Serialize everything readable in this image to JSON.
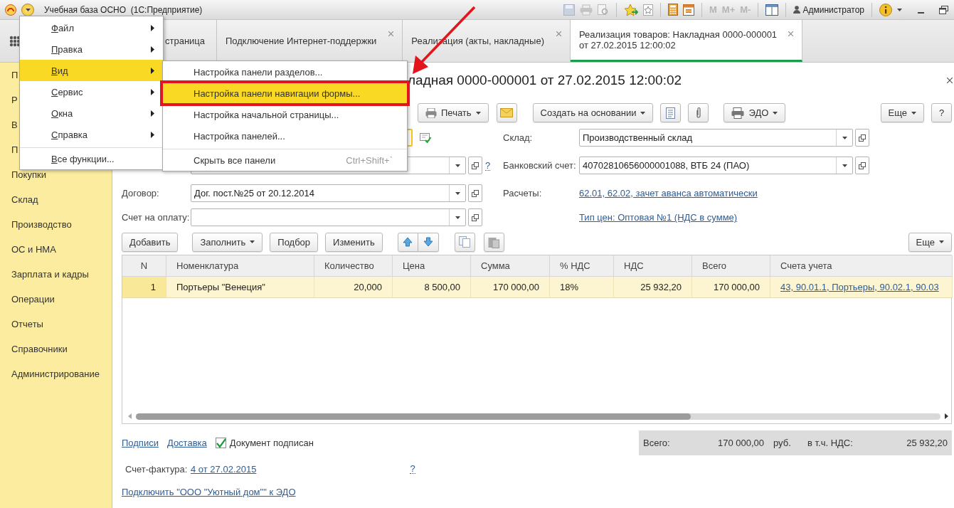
{
  "window": {
    "title": "Учебная база ОСНО  (1С:Предприятие)",
    "memory_buttons": [
      {
        "label": "M",
        "disabled": true
      },
      {
        "label": "M+",
        "disabled": true
      },
      {
        "label": "M-",
        "disabled": true
      }
    ],
    "user": "Администратор"
  },
  "tabs": [
    {
      "label": "страница",
      "selected": false,
      "closable": false
    },
    {
      "label": "Подключение Интернет-поддержки",
      "selected": false,
      "closable": true
    },
    {
      "label": "Реализация (акты, накладные)",
      "selected": false,
      "closable": true
    },
    {
      "label": "Реализация товаров: Накладная 0000-000001 от 27.02.2015 12:00:02",
      "selected": true,
      "closable": true
    }
  ],
  "sidebar": {
    "items": [
      {
        "label": "П"
      },
      {
        "label": "Р"
      },
      {
        "label": "В"
      },
      {
        "label": "П"
      },
      {
        "label": "Покупки"
      },
      {
        "label": "Склад"
      },
      {
        "label": "Производство"
      },
      {
        "label": "ОС и НМА"
      },
      {
        "label": "Зарплата и кадры"
      },
      {
        "label": "Операции"
      },
      {
        "label": "Отчеты"
      },
      {
        "label": "Справочники"
      },
      {
        "label": "Администрирование"
      }
    ]
  },
  "main_menu": {
    "items": [
      {
        "label": "Файл",
        "selected": false,
        "has_submenu": true,
        "separator_before": false
      },
      {
        "label": "Правка",
        "selected": false,
        "has_submenu": true,
        "separator_before": false
      },
      {
        "label": "Вид",
        "selected": true,
        "has_submenu": true,
        "separator_before": false
      },
      {
        "label": "Сервис",
        "selected": false,
        "has_submenu": true,
        "separator_before": false
      },
      {
        "label": "Окна",
        "selected": false,
        "has_submenu": true,
        "separator_before": false
      },
      {
        "label": "Справка",
        "selected": false,
        "has_submenu": true,
        "separator_before": false
      },
      {
        "label": "Все функции...",
        "selected": false,
        "has_submenu": false,
        "separator_before": true
      }
    ]
  },
  "submenu": {
    "items": [
      {
        "label": "Настройка панели разделов...",
        "selected": false,
        "highlighted": false,
        "separator_before": false
      },
      {
        "label": "Настройка панели навигации формы...",
        "selected": true,
        "highlighted": true,
        "separator_before": false
      },
      {
        "label": "Настройка начальной страницы...",
        "selected": false,
        "highlighted": false,
        "separator_before": false
      },
      {
        "label": "Настройка панелей...",
        "selected": false,
        "highlighted": false,
        "separator_before": false
      },
      {
        "label": "Скрыть все панели",
        "shortcut": "Ctrl+Shift+`",
        "selected": false,
        "highlighted": false,
        "separator_before": true
      }
    ]
  },
  "form": {
    "title": "ладная 0000-000001 от 27.02.2015 12:00:02",
    "toolbar": [
      {
        "kind": "print",
        "label": "Печать",
        "dropdown": true
      },
      {
        "kind": "mail"
      },
      {
        "kind": "text",
        "label": "Создать на основании",
        "dropdown": true
      },
      {
        "kind": "report"
      },
      {
        "kind": "attach"
      },
      {
        "kind": "edo",
        "label": "ЭДО",
        "dropdown": true
      }
    ],
    "more": "Еще",
    "help": "?",
    "field_rows": [
      {
        "left": {
          "kind": "focused"
        },
        "right": {
          "kind": "select",
          "label": "Склад:",
          "value": "Производственный склад"
        }
      },
      {
        "left": {
          "kind": "select",
          "help": "?"
        },
        "right": {
          "kind": "select",
          "label": "Банковский счет:",
          "value": "40702810656000001088, ВТБ 24 (ПАО)"
        }
      },
      {
        "left": {
          "kind": "select",
          "label": "Договор:",
          "value": "Дог. пост.№25 от 20.12.2014"
        },
        "right": {
          "kind": "link",
          "label": "Расчеты:",
          "value": "62.01, 62.02, зачет аванса автоматически"
        }
      },
      {
        "left": {
          "kind": "select",
          "label": "Счет на оплату:"
        },
        "right": {
          "kind": "link",
          "value": "Тип цен: Оптовая №1 (НДС в сумме)"
        }
      }
    ],
    "table_toolbar": {
      "buttons": [
        {
          "kind": "text",
          "label": "Добавить"
        },
        {
          "kind": "text",
          "label": "Заполнить",
          "dropdown": true
        },
        {
          "kind": "text",
          "label": "Подбор"
        },
        {
          "kind": "text",
          "label": "Изменить"
        },
        {
          "kind": "up"
        },
        {
          "kind": "down"
        },
        {
          "kind": "copy"
        },
        {
          "kind": "paste"
        }
      ],
      "more": "Еще"
    },
    "table": {
      "columns": [
        {
          "label": "N",
          "kind": "index"
        },
        {
          "label": "Номенклатура",
          "kind": "text"
        },
        {
          "label": "Количество",
          "kind": "number"
        },
        {
          "label": "Цена",
          "kind": "number"
        },
        {
          "label": "Сумма",
          "kind": "number"
        },
        {
          "label": "% НДС",
          "kind": "text"
        },
        {
          "label": "НДС",
          "kind": "number"
        },
        {
          "label": "Всего",
          "kind": "number"
        },
        {
          "label": "Счета учета",
          "kind": "link"
        }
      ],
      "rows": [
        {
          "selected": true,
          "cells": [
            "1",
            "Портьеры \"Венеция\"",
            "20,000",
            "8 500,00",
            "170 000,00",
            "18%",
            "25 932,20",
            "170 000,00",
            "43, 90.01.1, Портьеры, 90.02.1, 90.03"
          ]
        }
      ]
    }
  },
  "footer": {
    "links": [
      "Подписи",
      "Доставка"
    ],
    "signed": {
      "label": "Документ подписан",
      "checked": true
    },
    "totals": {
      "total_label": "Всего:",
      "total": "170 000,00",
      "currency": "руб.",
      "vat_label": "в т.ч. НДС:",
      "vat": "25 932,20"
    },
    "invoice": {
      "label": "Счет-фактура:",
      "link": "4 от 27.02.2015",
      "help": "?"
    },
    "connect_link": "Подключить \"ООО \"Уютный дом\"\" к ЭДО"
  }
}
